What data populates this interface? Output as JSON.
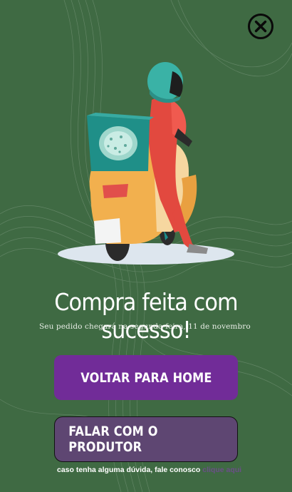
{
  "colors": {
    "background": "#3f6a43",
    "primary_button": "#712c98",
    "secondary_button": "#5e4672",
    "link": "#6b4e88"
  },
  "close": {
    "icon": "close-icon"
  },
  "hero": {
    "illustration": "delivery-scooter-illustration"
  },
  "success": {
    "title": "Compra feita com sucesso!",
    "subtitle": "Seu pedido chegará na segunda-feira, 11 de novembro"
  },
  "actions": {
    "home_label": "VOLTAR PARA HOME",
    "producer_label": "FALAR COM O PRODUTOR"
  },
  "footer": {
    "text": "caso tenha alguma dúvida, fale conosco",
    "link_label": "clique aqui"
  }
}
